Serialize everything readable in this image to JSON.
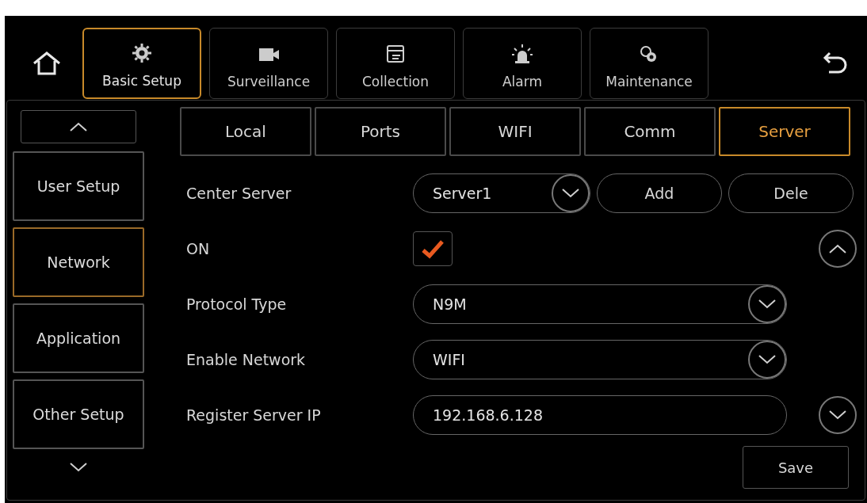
{
  "top_nav": {
    "items": [
      {
        "label": "Basic Setup",
        "selected": true
      },
      {
        "label": "Surveillance",
        "selected": false
      },
      {
        "label": "Collection",
        "selected": false
      },
      {
        "label": "Alarm",
        "selected": false
      },
      {
        "label": "Maintenance",
        "selected": false
      }
    ]
  },
  "sidebar": {
    "items": [
      {
        "label": "User Setup",
        "selected": false
      },
      {
        "label": "Network",
        "selected": true
      },
      {
        "label": "Application",
        "selected": false
      },
      {
        "label": "Other Setup",
        "selected": false
      }
    ]
  },
  "tabs": [
    {
      "label": "Local",
      "selected": false
    },
    {
      "label": "Ports",
      "selected": false
    },
    {
      "label": "WIFI",
      "selected": false
    },
    {
      "label": "Comm",
      "selected": false
    },
    {
      "label": "Server",
      "selected": true
    }
  ],
  "form": {
    "rows": [
      {
        "kind": "select_actions",
        "label": "Center Server",
        "value": "Server1",
        "buttons": [
          "Add",
          "Dele"
        ]
      },
      {
        "kind": "checkbox",
        "label": "ON",
        "checked": true
      },
      {
        "kind": "select",
        "label": "Protocol Type",
        "value": "N9M"
      },
      {
        "kind": "select",
        "label": "Enable Network",
        "value": "WIFI"
      },
      {
        "kind": "text",
        "label": "Register Server IP",
        "value": "192.168.6.128"
      }
    ]
  },
  "save_button": "Save"
}
